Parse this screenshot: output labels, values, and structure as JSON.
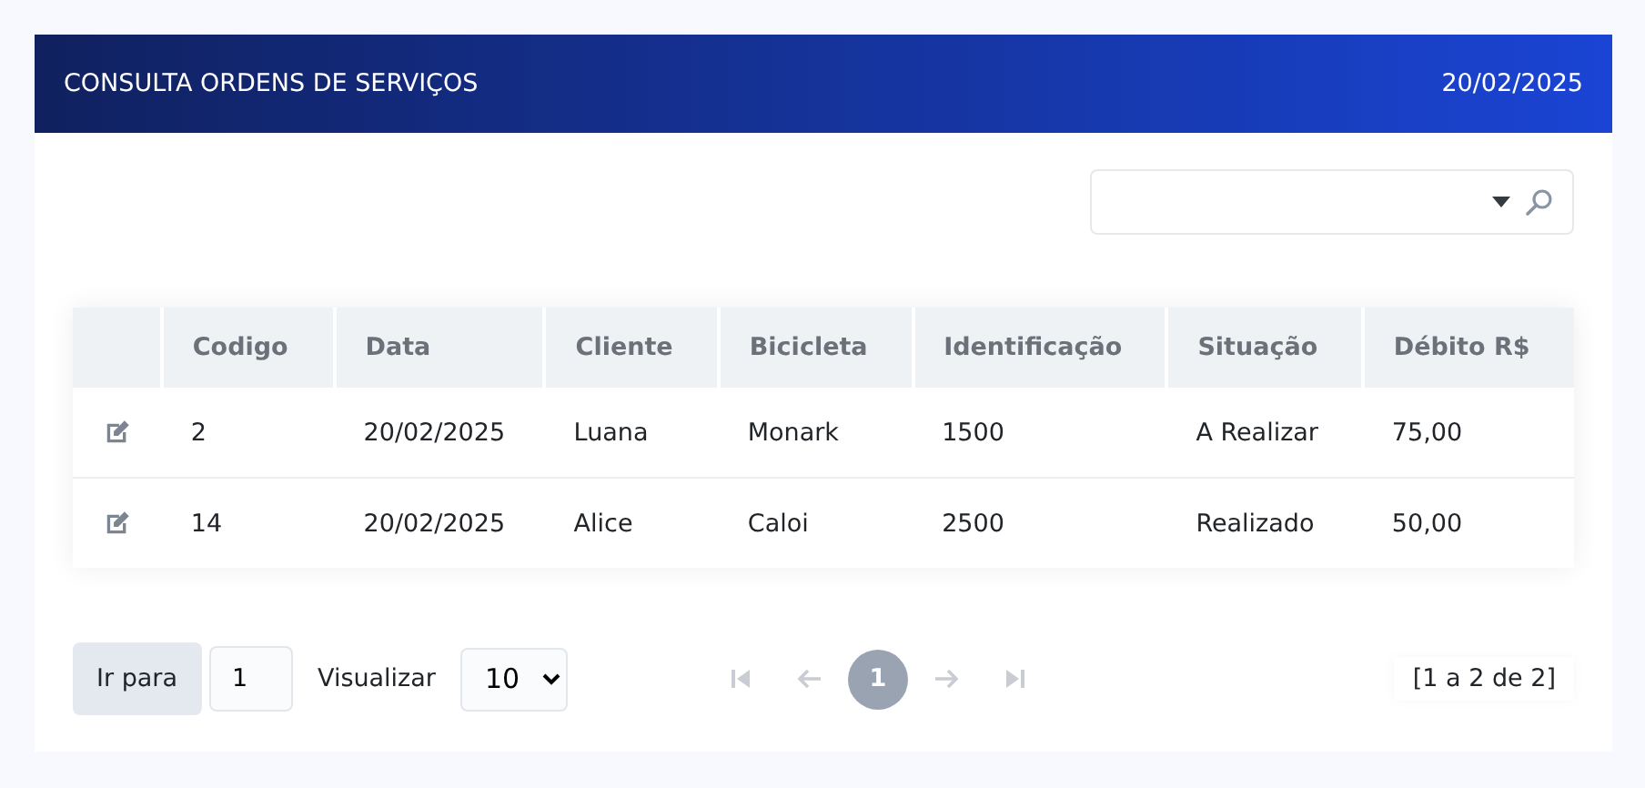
{
  "header": {
    "title": "CONSULTA ORDENS DE SERVIÇOS",
    "date": "20/02/2025"
  },
  "table": {
    "columns": [
      "Codigo",
      "Data",
      "Cliente",
      "Bicicleta",
      "Identificação",
      "Situação",
      "Débito R$"
    ],
    "rows": [
      {
        "cells": [
          "2",
          "20/02/2025",
          "Luana",
          "Monark",
          "1500",
          "A Realizar",
          "75,00"
        ]
      },
      {
        "cells": [
          "14",
          "20/02/2025",
          "Alice",
          "Caloi",
          "2500",
          "Realizado",
          "50,00"
        ]
      }
    ]
  },
  "pagination": {
    "goto_label": "Ir para",
    "goto_value": "1",
    "view_label": "Visualizar",
    "page_size": "10",
    "nav": [
      {
        "kind": "first",
        "disabled": true
      },
      {
        "kind": "prev",
        "disabled": true
      },
      {
        "kind": "next",
        "disabled": true
      },
      {
        "kind": "last",
        "disabled": true
      }
    ],
    "pages": [
      {
        "label": "1",
        "selected": true
      }
    ],
    "summary": "[1 a 2 de 2]"
  }
}
